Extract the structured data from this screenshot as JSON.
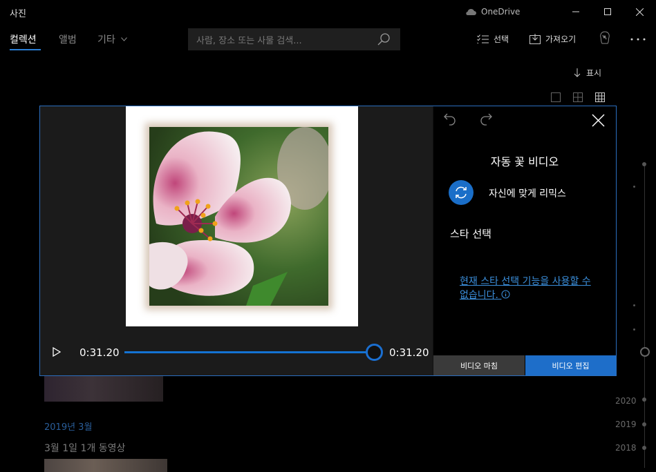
{
  "app": {
    "title": "사진",
    "onedrive_label": "OneDrive"
  },
  "nav": {
    "tabs": [
      {
        "label": "컬렉션",
        "active": true
      },
      {
        "label": "앨범"
      },
      {
        "label": "기타"
      }
    ],
    "search": {
      "placeholder": "사람, 장소 또는 사물 검색..."
    },
    "commands": {
      "select": "선택",
      "import": "가져오기"
    }
  },
  "view": {
    "label": "표시"
  },
  "background": {
    "month_heading": "2019년 3월",
    "day_label": "3월 1일   1개 동영상"
  },
  "timeline": {
    "years": [
      "2020",
      "2019",
      "2018"
    ]
  },
  "player": {
    "current_time": "0:31.20",
    "total_time": "0:31.20",
    "progress": 1.0
  },
  "panel": {
    "title": "자동 꽃 비디오",
    "remix_label": "자신에 맞게 리믹스",
    "star_heading": "스타 선택",
    "star_note": "현재 스타 선택 기능을 사용할 수 없습니다.",
    "finish_button": "비디오 마침",
    "edit_button": "비디오 편집"
  },
  "colors": {
    "accent": "#1e6ec9",
    "link": "#3b8fdc",
    "dialog_border": "#2b6fc0"
  }
}
